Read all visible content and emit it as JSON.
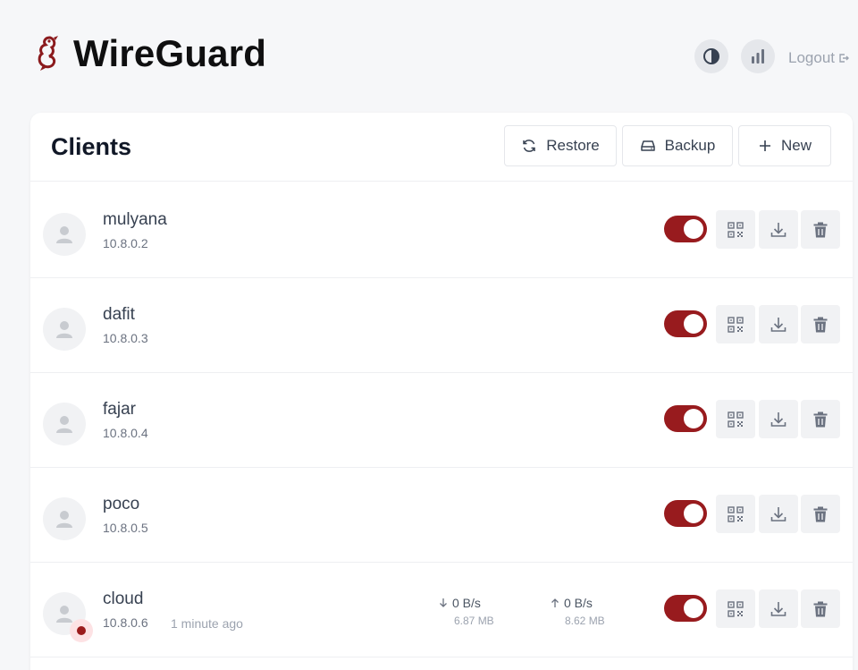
{
  "app": {
    "title": "WireGuard",
    "logout_label": "Logout"
  },
  "clients_card": {
    "title": "Clients",
    "restore_label": "Restore",
    "backup_label": "Backup",
    "new_label": "New"
  },
  "clients": [
    {
      "name": "mulyana",
      "ip": "10.8.0.2",
      "enabled": true
    },
    {
      "name": "dafit",
      "ip": "10.8.0.3",
      "enabled": true
    },
    {
      "name": "fajar",
      "ip": "10.8.0.4",
      "enabled": true
    },
    {
      "name": "poco",
      "ip": "10.8.0.5",
      "enabled": true
    },
    {
      "name": "cloud",
      "ip": "10.8.0.6",
      "enabled": true,
      "online": true,
      "last_seen": "1 minute ago",
      "rx_rate": "0 B/s",
      "rx_total": "6.87 MB",
      "tx_rate": "0 B/s",
      "tx_total": "8.62 MB"
    }
  ],
  "colors": {
    "accent": "#981b1e",
    "background": "#f6f7f9",
    "card": "#ffffff",
    "action_bg": "#f1f2f4"
  },
  "icons": {
    "brand": "wireguard-dragon-icon",
    "theme": "contrast-icon",
    "stats": "bar-chart-icon",
    "logout": "logout-icon",
    "restore": "refresh-icon",
    "backup": "drive-icon",
    "new": "plus-icon",
    "avatar": "user-icon",
    "qr": "qrcode-icon",
    "download": "download-icon",
    "delete": "trash-icon",
    "rx": "arrow-down-icon",
    "tx": "arrow-up-icon"
  }
}
